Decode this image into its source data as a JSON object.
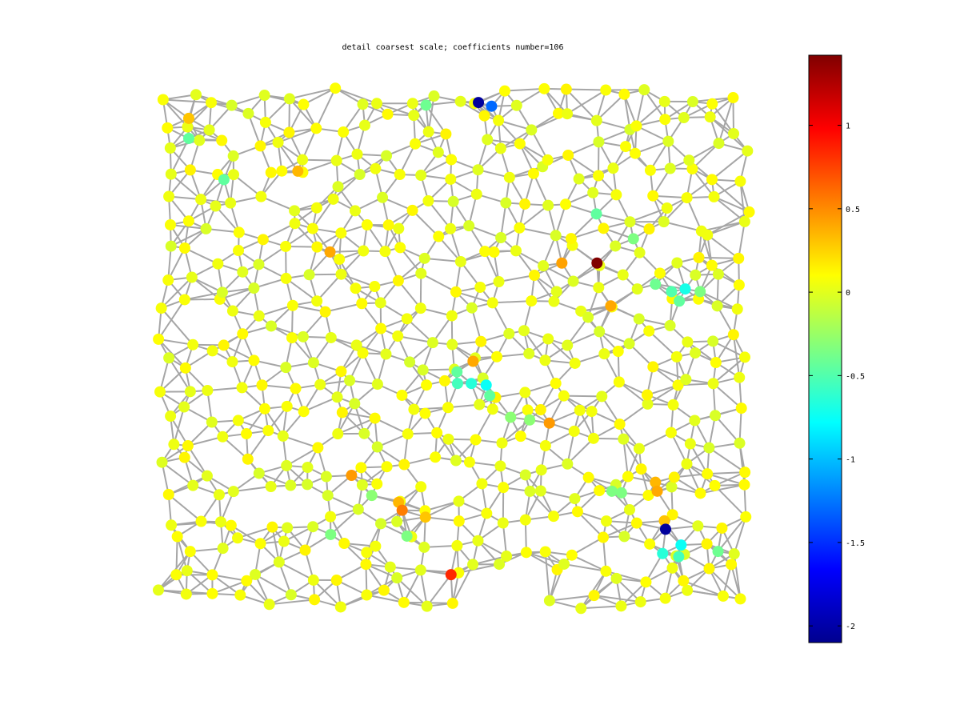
{
  "chart_data": {
    "type": "scatter",
    "title": "detail coarsest scale; coefficients number=106",
    "colorbar": {
      "colormap": "jet",
      "range": [
        -2.1,
        1.42
      ],
      "ticks": [
        1,
        0.5,
        0,
        -0.5,
        -1,
        -1.5,
        -2
      ],
      "tick_labels": [
        "1",
        "0.5",
        "0",
        "-0.5",
        "-1",
        "-1.5",
        "-2"
      ]
    },
    "domain": {
      "x": [
        0,
        1
      ],
      "y": [
        0,
        1
      ]
    },
    "edge_color": "#a6a6a6",
    "graph": {
      "description_values": "nodes are graph vertices; color encodes coefficient value",
      "seed": 7,
      "node_count": 500,
      "knn": 5
    },
    "highlighted_points": [
      {
        "x": 0.541,
        "y": 0.965,
        "value": -2.0
      },
      {
        "x": 0.563,
        "y": 0.958,
        "value": -1.3
      },
      {
        "x": 0.453,
        "y": 0.96,
        "value": -0.4
      },
      {
        "x": 0.055,
        "y": 0.935,
        "value": 0.3
      },
      {
        "x": 0.055,
        "y": 0.897,
        "value": -0.45
      },
      {
        "x": 0.114,
        "y": 0.819,
        "value": -0.45
      },
      {
        "x": 0.238,
        "y": 0.835,
        "value": 0.35
      },
      {
        "x": 0.292,
        "y": 0.682,
        "value": 0.4
      },
      {
        "x": 0.74,
        "y": 0.661,
        "value": 1.42
      },
      {
        "x": 0.681,
        "y": 0.661,
        "value": 0.42
      },
      {
        "x": 0.739,
        "y": 0.754,
        "value": -0.45
      },
      {
        "x": 0.801,
        "y": 0.707,
        "value": -0.35
      },
      {
        "x": 0.838,
        "y": 0.621,
        "value": -0.4
      },
      {
        "x": 0.888,
        "y": 0.612,
        "value": -0.7
      },
      {
        "x": 0.865,
        "y": 0.607,
        "value": -0.5
      },
      {
        "x": 0.913,
        "y": 0.607,
        "value": -0.35
      },
      {
        "x": 0.878,
        "y": 0.589,
        "value": -0.45
      },
      {
        "x": 0.763,
        "y": 0.58,
        "value": 0.4
      },
      {
        "x": 0.532,
        "y": 0.475,
        "value": 0.4
      },
      {
        "x": 0.505,
        "y": 0.455,
        "value": -0.45
      },
      {
        "x": 0.529,
        "y": 0.433,
        "value": -0.65
      },
      {
        "x": 0.554,
        "y": 0.43,
        "value": -0.75
      },
      {
        "x": 0.506,
        "y": 0.433,
        "value": -0.55
      },
      {
        "x": 0.56,
        "y": 0.41,
        "value": -0.45
      },
      {
        "x": 0.66,
        "y": 0.358,
        "value": 0.45
      },
      {
        "x": 0.627,
        "y": 0.364,
        "value": -0.3
      },
      {
        "x": 0.595,
        "y": 0.369,
        "value": -0.3
      },
      {
        "x": 0.328,
        "y": 0.259,
        "value": 0.45
      },
      {
        "x": 0.407,
        "y": 0.208,
        "value": 0.35
      },
      {
        "x": 0.413,
        "y": 0.193,
        "value": 0.55
      },
      {
        "x": 0.452,
        "y": 0.18,
        "value": 0.3
      },
      {
        "x": 0.362,
        "y": 0.221,
        "value": -0.3
      },
      {
        "x": 0.495,
        "y": 0.071,
        "value": 0.85
      },
      {
        "x": 0.838,
        "y": 0.246,
        "value": 0.35
      },
      {
        "x": 0.841,
        "y": 0.229,
        "value": 0.4
      },
      {
        "x": 0.853,
        "y": 0.173,
        "value": 0.3
      },
      {
        "x": 0.855,
        "y": 0.157,
        "value": -2.0
      },
      {
        "x": 0.881,
        "y": 0.127,
        "value": -0.75
      },
      {
        "x": 0.85,
        "y": 0.111,
        "value": -0.65
      },
      {
        "x": 0.877,
        "y": 0.105,
        "value": -0.55
      },
      {
        "x": 0.943,
        "y": 0.115,
        "value": -0.4
      },
      {
        "x": 0.781,
        "y": 0.226,
        "value": -0.35
      },
      {
        "x": 0.765,
        "y": 0.229,
        "value": -0.35
      },
      {
        "x": 0.293,
        "y": 0.147,
        "value": -0.35
      },
      {
        "x": 0.421,
        "y": 0.144,
        "value": -0.35
      }
    ]
  }
}
